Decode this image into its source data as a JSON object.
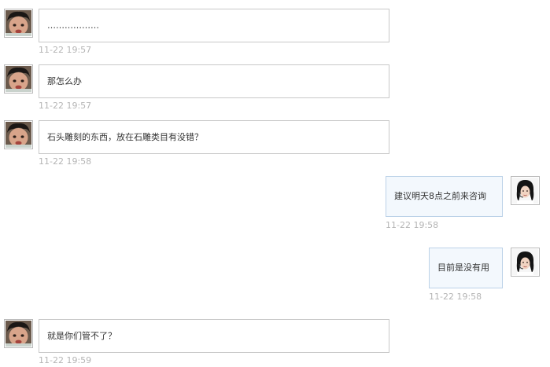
{
  "colors": {
    "incoming_bubble_bg": "#ffffff",
    "incoming_bubble_border": "#c8c8c8",
    "outgoing_bubble_bg": "#f3f8fd",
    "outgoing_bubble_border": "#bcd2e8",
    "timestamp": "#b5b5b5",
    "text": "#333333"
  },
  "messages": [
    {
      "sender": "customer",
      "text": "………………",
      "time": "11-22 19:57",
      "avatar_icon": "child-avatar-icon"
    },
    {
      "sender": "customer",
      "text": "那怎么办",
      "time": "11-22 19:57",
      "avatar_icon": "child-avatar-icon"
    },
    {
      "sender": "customer",
      "text": "石头雕刻的东西，放在石雕类目有没错？",
      "time": "11-22 19:58",
      "avatar_icon": "child-avatar-icon"
    },
    {
      "sender": "agent",
      "text": "建议明天8点之前来咨询",
      "time": "11-22 19:58",
      "avatar_icon": "headset-agent-avatar-icon"
    },
    {
      "sender": "agent",
      "text": "目前是没有用",
      "time": "11-22 19:58",
      "avatar_icon": "headset-agent-avatar-icon"
    },
    {
      "sender": "customer",
      "text": "就是你们管不了？",
      "time": "11-22 19:59",
      "avatar_icon": "child-avatar-icon"
    }
  ]
}
